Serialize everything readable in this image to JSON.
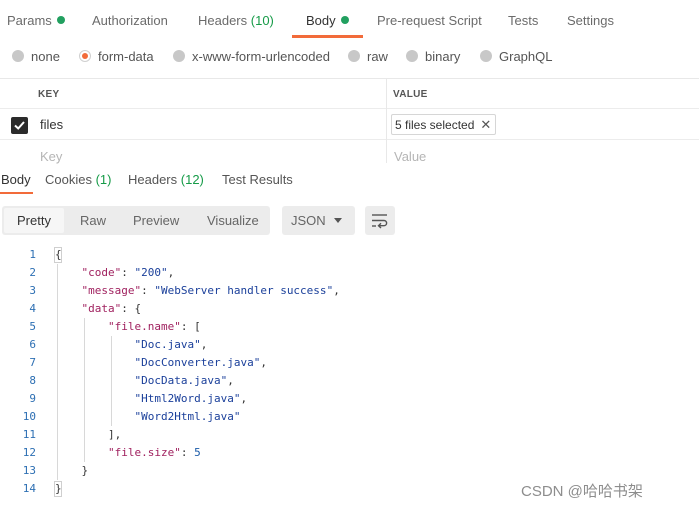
{
  "request_tabs": [
    {
      "label": "Params",
      "dot": true
    },
    {
      "label": "Authorization"
    },
    {
      "label": "Headers",
      "count": "(10)"
    },
    {
      "label": "Body",
      "dot": true,
      "active": true
    },
    {
      "label": "Pre-request Script"
    },
    {
      "label": "Tests"
    },
    {
      "label": "Settings"
    }
  ],
  "body_types": [
    "none",
    "form-data",
    "x-www-form-urlencoded",
    "raw",
    "binary",
    "GraphQL"
  ],
  "selected_body_type": "form-data",
  "kv_table": {
    "headers": {
      "key": "KEY",
      "value": "VALUE"
    },
    "rows": [
      {
        "checked": true,
        "key": "files",
        "value": "5 files selected"
      }
    ],
    "placeholder": {
      "key": "Key",
      "value": "Value"
    }
  },
  "response_tabs": [
    {
      "label": "Body",
      "active": true
    },
    {
      "label": "Cookies",
      "count": "(1)"
    },
    {
      "label": "Headers",
      "count": "(12)"
    },
    {
      "label": "Test Results"
    }
  ],
  "view_modes": [
    "Pretty",
    "Raw",
    "Preview",
    "Visualize"
  ],
  "active_view_mode": "Pretty",
  "format": "JSON",
  "line_numbers": [
    "1",
    "2",
    "3",
    "4",
    "5",
    "6",
    "7",
    "8",
    "9",
    "10",
    "11",
    "12",
    "13",
    "14"
  ],
  "response_json": {
    "code": "200",
    "message": "WebServer handler success",
    "file_names": [
      "Doc.java",
      "DocConverter.java",
      "DocData.java",
      "Html2Word.java",
      "Word2Html.java"
    ],
    "file_size": "5"
  },
  "watermark": "CSDN @哈哈书架",
  "colors": {
    "accent": "#f26b3a",
    "status_green": "#22a060",
    "count_green": "#169b48"
  }
}
